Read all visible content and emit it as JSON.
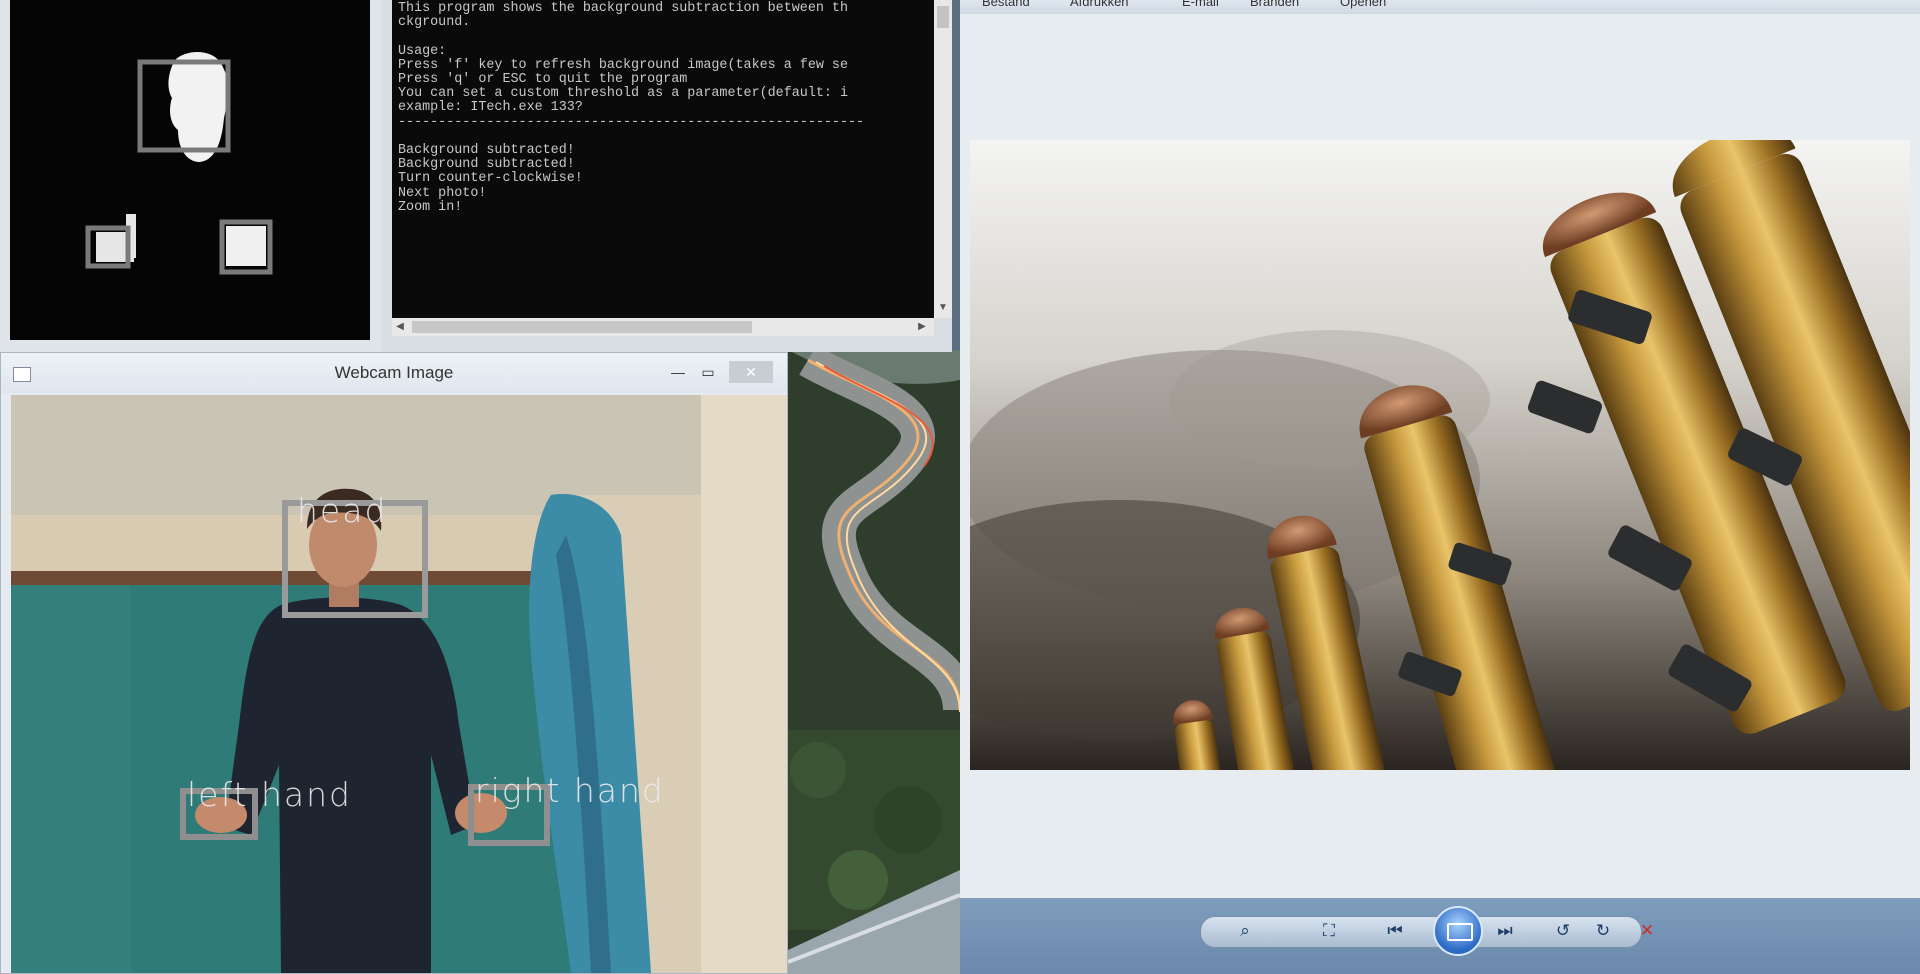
{
  "console": {
    "lines": [
      "This program shows the background subtraction between th",
      "ckground.",
      "",
      "Usage:",
      "Press 'f' key to refresh background image(takes a few se",
      "Press 'q' or ESC to quit the program",
      "You can set a custom threshold as a parameter(default: i",
      "example: ITech.exe 133?",
      "----------------------------------------------------------",
      "",
      "Background subtracted!",
      "Background subtracted!",
      "Turn counter-clockwise!",
      "Next photo!",
      "Zoom in!"
    ],
    "scroll_left_icon": "triangle-left",
    "scroll_right_icon": "triangle-right",
    "scroll_down_icon": "triangle-down"
  },
  "webcam": {
    "title": "Webcam Image",
    "minimize_glyph": "—",
    "maximize_glyph": "▭",
    "close_glyph": "✕",
    "labels": {
      "head": "head",
      "left_hand": "left hand",
      "right_hand": "right hand"
    }
  },
  "viewer": {
    "menu": [
      "Bestand",
      "Afdrukken",
      "E-mail",
      "Branden",
      "Openen"
    ],
    "toolbar_icons": [
      "zoom-icon",
      "fit-window-icon",
      "previous-icon",
      "slideshow-icon",
      "next-icon",
      "rotate-ccw-icon",
      "rotate-cw-icon",
      "delete-icon"
    ],
    "glyphs": {
      "zoom": "⌕",
      "fit": "⛶",
      "prev": "⏮",
      "next": "⏭",
      "rotate_ccw": "↺",
      "rotate_cw": "↻",
      "delete": "✕"
    },
    "colors": {
      "delete": "#d22a2a",
      "accent": "#2a69c4"
    }
  }
}
